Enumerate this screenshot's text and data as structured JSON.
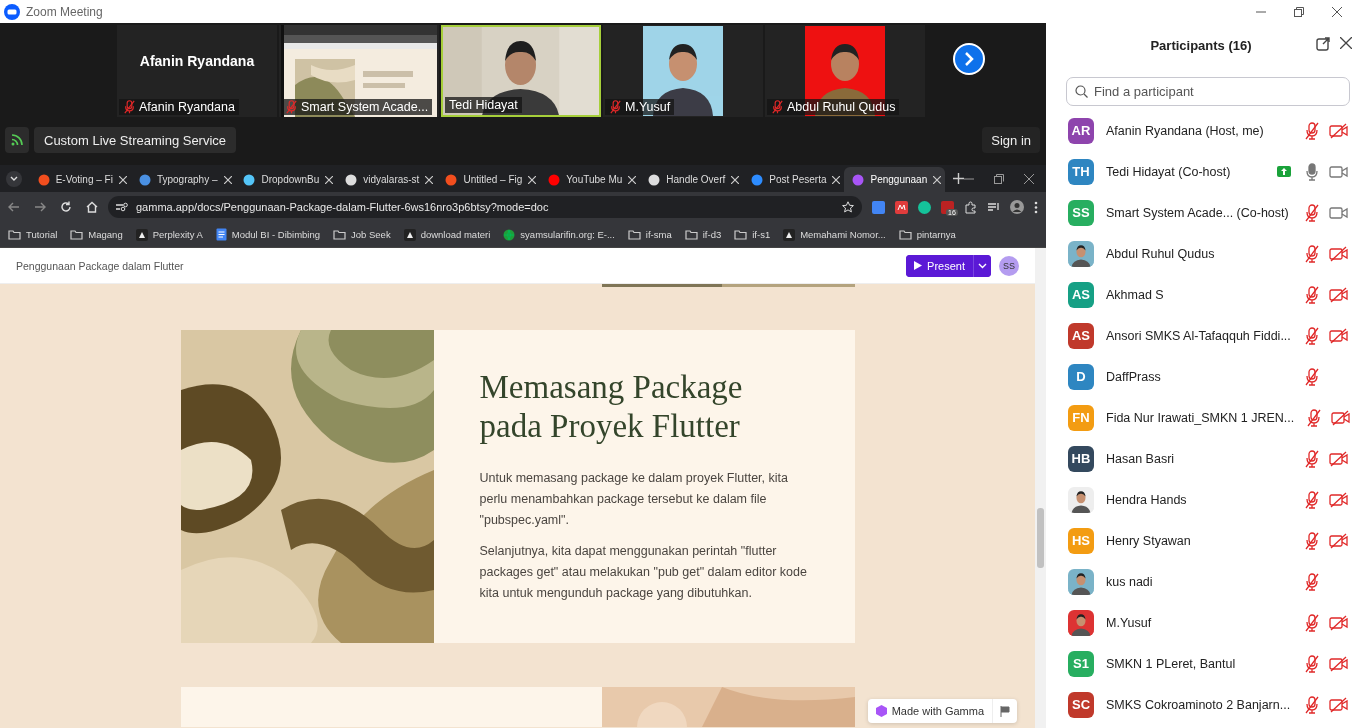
{
  "window": {
    "title": "Zoom Meeting"
  },
  "video_strip": {
    "tiles": [
      {
        "kind": "name",
        "display_name": "Afanin Ryandana",
        "label": "Afanin Ryandana",
        "muted": true,
        "speaking": false
      },
      {
        "kind": "screen",
        "label": "Smart System Acade...",
        "muted": true,
        "speaking": false
      },
      {
        "kind": "camera",
        "label": "Tedi Hidayat",
        "muted": false,
        "speaking": true
      },
      {
        "kind": "portrait",
        "label": "M.Yusuf",
        "muted": true,
        "speaking": false
      },
      {
        "kind": "portrait",
        "label": "Abdul Ruhul Qudus",
        "muted": true,
        "speaking": false
      }
    ]
  },
  "live_button": "Custom Live Streaming Service",
  "sign_in": "Sign in",
  "browser": {
    "tabs": [
      {
        "label": "E-Voting – Fi",
        "kind": "figma",
        "selected": false
      },
      {
        "label": "Typography –",
        "kind": "circle",
        "selected": false
      },
      {
        "label": "DropdownBu",
        "kind": "flutter",
        "selected": false
      },
      {
        "label": "vidyalaras-st",
        "kind": "github",
        "selected": false
      },
      {
        "label": "Untitled – Fig",
        "kind": "figma",
        "selected": false
      },
      {
        "label": "YouTube Mu",
        "kind": "youtube",
        "selected": false
      },
      {
        "label": "Handle Overf",
        "kind": "chatgpt",
        "selected": false
      },
      {
        "label": "Post Peserta",
        "kind": "zoom",
        "selected": false
      },
      {
        "label": "Penggunaan",
        "kind": "gamma",
        "selected": true
      }
    ],
    "url": "gamma.app/docs/Penggunaan-Package-dalam-Flutter-6ws16nro3p6btsy?mode=doc",
    "extension_badge": "16",
    "bookmarks": [
      {
        "label": "Tutorial",
        "kind": "folder"
      },
      {
        "label": "Magang",
        "kind": "folder"
      },
      {
        "label": "Perplexity A",
        "kind": "site"
      },
      {
        "label": "Modul BI - Dibimbing",
        "kind": "doc"
      },
      {
        "label": "Job Seek",
        "kind": "folder"
      },
      {
        "label": "download materi",
        "kind": "site"
      },
      {
        "label": "syamsularifin.org: E-...",
        "kind": "globe"
      },
      {
        "label": "if-sma",
        "kind": "folder"
      },
      {
        "label": "if-d3",
        "kind": "folder"
      },
      {
        "label": "if-s1",
        "kind": "folder"
      },
      {
        "label": "Memahami Nomor...",
        "kind": "site"
      },
      {
        "label": "pintarnya",
        "kind": "folder"
      }
    ]
  },
  "document": {
    "title": "Penggunaan Package dalam Flutter",
    "present_button": "Present",
    "avatar": "SS",
    "slide": {
      "heading": [
        "Memasang Package",
        "pada Proyek Flutter"
      ],
      "paragraphs": [
        "Untuk memasang package ke dalam proyek Flutter, kita perlu menambahkan package tersebut ke dalam file \"pubspec.yaml\".",
        "Selanjutnya, kita dapat menggunakan perintah \"flutter packages get\" atau melakukan \"pub get\" dalam editor kode kita untuk mengunduh package yang dibutuhkan."
      ]
    },
    "made_with": "Made with Gamma"
  },
  "participants": {
    "title": "Participants (16)",
    "search": {
      "placeholder": "Find a participant"
    },
    "items": [
      {
        "kind": "initials",
        "initials": "AR",
        "color": "#8e44ad",
        "name": "Afanin Ryandana (Host, me)",
        "sharing": false,
        "mic_muted": true,
        "video_off": true
      },
      {
        "kind": "initials",
        "initials": "TH",
        "color": "#2e86c1",
        "name": "Tedi Hidayat (Co-host)",
        "sharing": true,
        "mic_muted": false,
        "video_off": false
      },
      {
        "kind": "initials",
        "initials": "SS",
        "color": "#27ae60",
        "name": "Smart System Acade...  (Co-host)",
        "sharing": false,
        "mic_muted": true,
        "video_off": false
      },
      {
        "name": "Abdul Ruhul Qudus",
        "sharing": false,
        "mic_muted": true,
        "video_off": true
      },
      {
        "kind": "initials",
        "initials": "AS",
        "color": "#16a085",
        "name": "Akhmad S",
        "sharing": false,
        "mic_muted": true,
        "video_off": true
      },
      {
        "kind": "initials",
        "initials": "AS",
        "color": "#c0392b",
        "name": "Ansori SMKS Al-Tafaqquh Fiddi...",
        "sharing": false,
        "mic_muted": true,
        "video_off": true
      },
      {
        "kind": "initials",
        "initials": "D",
        "color": "#2e86c1",
        "name": "DaffPrass",
        "sharing": false,
        "mic_muted": true
      },
      {
        "kind": "initials",
        "initials": "FN",
        "color": "#f39c12",
        "name": "Fida Nur Irawati_SMKN 1 JREN...",
        "sharing": false,
        "mic_muted": true,
        "video_off": true
      },
      {
        "kind": "initials",
        "initials": "HB",
        "color": "#34495e",
        "name": "Hasan Basri",
        "sharing": false,
        "mic_muted": true,
        "video_off": true
      },
      {
        "name": "Hendra Hands",
        "sharing": false,
        "mic_muted": true,
        "video_off": true
      },
      {
        "kind": "initials",
        "initials": "HS",
        "color": "#f39c12",
        "name": "Henry Styawan",
        "sharing": false,
        "mic_muted": true,
        "video_off": true
      },
      {
        "name": "kus nadi",
        "sharing": false,
        "mic_muted": true
      },
      {
        "name": "M.Yusuf",
        "sharing": false,
        "mic_muted": true,
        "video_off": true
      },
      {
        "kind": "initials",
        "initials": "S1",
        "color": "#27ae60",
        "name": "SMKN 1 PLeret, Bantul",
        "sharing": false,
        "mic_muted": true,
        "video_off": true
      },
      {
        "kind": "initials",
        "initials": "SC",
        "color": "#c0392b",
        "name": "SMKS Cokroaminoto 2 Banjarn...",
        "sharing": false,
        "mic_muted": true,
        "video_off": true
      }
    ]
  }
}
